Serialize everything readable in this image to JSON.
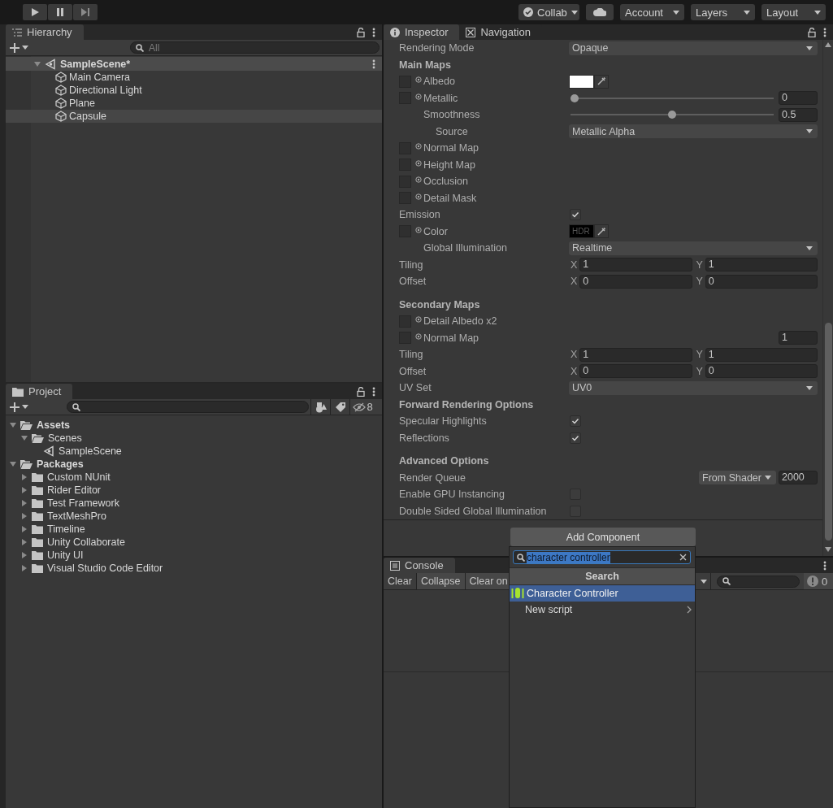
{
  "toolbar": {
    "buttons": [
      {
        "kind": "collab",
        "label": "Collab"
      },
      {
        "kind": "cloud"
      },
      {
        "kind": "dropdown",
        "label": "Account"
      },
      {
        "kind": "dropdown",
        "label": "Layers"
      },
      {
        "kind": "dropdown",
        "label": "Layout"
      }
    ]
  },
  "hierarchy": {
    "tab": "Hierarchy",
    "search": {
      "placeholder": "All"
    },
    "scene": {
      "label": "SampleScene*",
      "expanded": true
    },
    "items": [
      {
        "label": "Main Camera",
        "selected": false
      },
      {
        "label": "Directional Light",
        "selected": false
      },
      {
        "label": "Plane",
        "selected": false
      },
      {
        "label": "Capsule",
        "selected": true
      }
    ]
  },
  "project": {
    "tab": "Project",
    "hidden_count": "8",
    "tree": [
      {
        "kind": "folder",
        "label": "Assets",
        "expanded": true,
        "children": [
          {
            "kind": "folder",
            "label": "Scenes",
            "expanded": true,
            "children": [
              {
                "kind": "scene",
                "label": "SampleScene"
              }
            ]
          }
        ]
      },
      {
        "kind": "folder",
        "label": "Packages",
        "expanded": true,
        "children": [
          {
            "kind": "folder",
            "label": "Custom NUnit",
            "expanded": false
          },
          {
            "kind": "folder",
            "label": "Rider Editor",
            "expanded": false
          },
          {
            "kind": "folder",
            "label": "Test Framework",
            "expanded": false
          },
          {
            "kind": "folder",
            "label": "TextMeshPro",
            "expanded": false
          },
          {
            "kind": "folder",
            "label": "Timeline",
            "expanded": false
          },
          {
            "kind": "folder",
            "label": "Unity Collaborate",
            "expanded": false
          },
          {
            "kind": "folder",
            "label": "Unity UI",
            "expanded": false
          },
          {
            "kind": "folder",
            "label": "Visual Studio Code Editor",
            "expanded": false
          }
        ]
      }
    ]
  },
  "inspector": {
    "tabs": [
      {
        "label": "Inspector",
        "selected": true
      },
      {
        "label": "Navigation",
        "selected": false
      }
    ],
    "rows": [
      {
        "kind": "dropdown",
        "label": "Rendering Mode",
        "value": "Opaque"
      },
      {
        "kind": "header",
        "label": "Main Maps"
      },
      {
        "kind": "texture-color",
        "label": "Albedo",
        "color": "#ffffff"
      },
      {
        "kind": "texture-slider",
        "label": "Metallic",
        "level": 0,
        "value": "0",
        "children": [
          {
            "kind": "slider",
            "label": "Smoothness",
            "level": 0.5,
            "value": "0.5",
            "children": [
              {
                "kind": "dropdown",
                "label": "Source",
                "value": "Metallic Alpha"
              }
            ]
          }
        ]
      },
      {
        "kind": "texture",
        "label": "Normal Map"
      },
      {
        "kind": "texture",
        "label": "Height Map"
      },
      {
        "kind": "texture",
        "label": "Occlusion"
      },
      {
        "kind": "texture",
        "label": "Detail Mask"
      },
      {
        "kind": "checkbox",
        "label": "Emission",
        "checked": true,
        "children": [
          {
            "kind": "texture-color",
            "label": "Color",
            "color": "#000000",
            "badge": "HDR"
          },
          {
            "kind": "dropdown",
            "label": "Global Illumination",
            "value": "Realtime"
          }
        ]
      },
      {
        "kind": "vector2",
        "label": "Tiling",
        "fields": [
          {
            "axis": "X",
            "value": "1"
          },
          {
            "axis": "Y",
            "value": "1"
          }
        ]
      },
      {
        "kind": "vector2",
        "label": "Offset",
        "fields": [
          {
            "axis": "X",
            "value": "0"
          },
          {
            "axis": "Y",
            "value": "0"
          }
        ]
      },
      {
        "kind": "spacer"
      },
      {
        "kind": "header",
        "label": "Secondary Maps"
      },
      {
        "kind": "texture",
        "label": "Detail Albedo x2"
      },
      {
        "kind": "texture-float",
        "label": "Normal Map",
        "value": "1"
      },
      {
        "kind": "vector2",
        "label": "Tiling",
        "fields": [
          {
            "axis": "X",
            "value": "1"
          },
          {
            "axis": "Y",
            "value": "1"
          }
        ]
      },
      {
        "kind": "vector2",
        "label": "Offset",
        "fields": [
          {
            "axis": "X",
            "value": "0"
          },
          {
            "axis": "Y",
            "value": "0"
          }
        ]
      },
      {
        "kind": "dropdown",
        "label": "UV Set",
        "value": "UV0"
      },
      {
        "kind": "header",
        "label": "Forward Rendering Options"
      },
      {
        "kind": "checkbox",
        "label": "Specular Highlights",
        "checked": true
      },
      {
        "kind": "checkbox",
        "label": "Reflections",
        "checked": true
      },
      {
        "kind": "spacer"
      },
      {
        "kind": "header",
        "label": "Advanced Options"
      },
      {
        "kind": "queue",
        "label": "Render Queue",
        "mode": "From Shader",
        "value": "2000"
      },
      {
        "kind": "checkbox",
        "label": "Enable GPU Instancing",
        "checked": false
      },
      {
        "kind": "checkbox",
        "label": "Double Sided Global Illumination",
        "checked": false
      }
    ],
    "add_component": "Add Component"
  },
  "console": {
    "tab": "Console",
    "buttons": [
      {
        "kind": "button",
        "label": "Clear"
      },
      {
        "kind": "toggle",
        "label": "Collapse"
      },
      {
        "kind": "toggle",
        "label": "Clear on"
      }
    ],
    "error_count": "0"
  },
  "component_popup": {
    "query": "character controller",
    "header": "Search",
    "items": [
      {
        "kind": "component",
        "label": "Character Controller",
        "selected": true
      },
      {
        "kind": "submenu",
        "label": "New script",
        "selected": false
      }
    ]
  }
}
